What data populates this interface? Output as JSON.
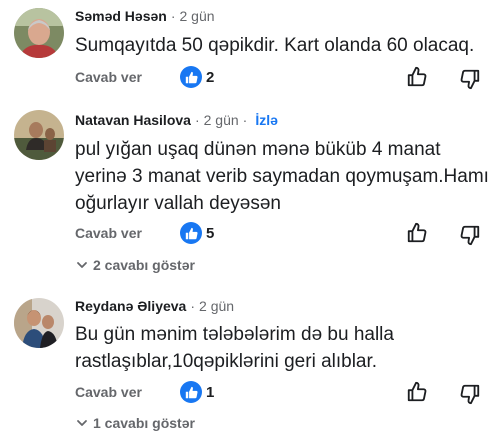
{
  "comments": [
    {
      "author": "Səməd Həsən",
      "time": "2 gün",
      "follow": "",
      "text": "Sumqayıtda 50 qəpikdir. Kart olanda 60 olacaq.",
      "reply_label": "Cavab ver",
      "like_count": "2",
      "replies_label": ""
    },
    {
      "author": "Natavan Hasilova",
      "time": "2 gün",
      "follow": "İzlə",
      "text": "pul yığan uşaq dünən mənə büküb 4 manat yerinə 3 manat verib saymadan qoymuşam.Hamı oğurlayır vallah deyəsən",
      "reply_label": "Cavab ver",
      "like_count": "5",
      "replies_label": "2 cavabı göstər"
    },
    {
      "author": "Reydanə Əliyeva",
      "time": "2 gün",
      "follow": "",
      "text": "Bu gün mənim tələbələrim də bu halla rastlaşıblar,10qəpiklərini geri alıblar.",
      "reply_label": "Cavab ver",
      "like_count": "1",
      "replies_label": "1 cavabı göstər"
    }
  ],
  "colors": {
    "accent": "#1877f2",
    "secondary_text": "#65676b",
    "primary_text": "#1c1e21"
  },
  "icons": {
    "like_badge": "thumbs-up-icon",
    "like": "thumbs-up-outline-icon",
    "dislike": "thumbs-down-outline-icon",
    "expand": "chevron-down-icon"
  }
}
